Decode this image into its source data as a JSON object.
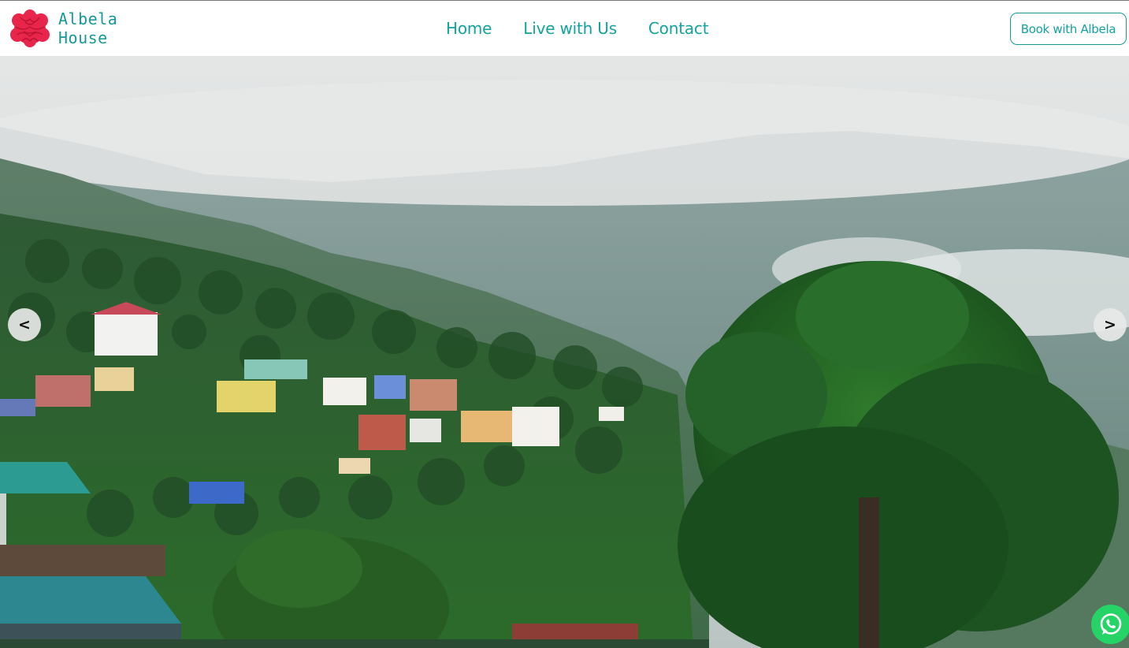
{
  "brand": {
    "line1": "Albela",
    "line2": "House",
    "logo_icon": "red-flower-logo-icon"
  },
  "nav": {
    "items": [
      {
        "label": "Home"
      },
      {
        "label": "Live with Us"
      },
      {
        "label": "Contact"
      }
    ]
  },
  "cta": {
    "book_label": "Book with Albela"
  },
  "carousel": {
    "prev_label": "<",
    "next_label": ">"
  },
  "chat": {
    "icon": "whatsapp-icon"
  },
  "colors": {
    "accent": "#13a39e",
    "logo": "#e8254a",
    "whatsapp": "#25d366"
  }
}
